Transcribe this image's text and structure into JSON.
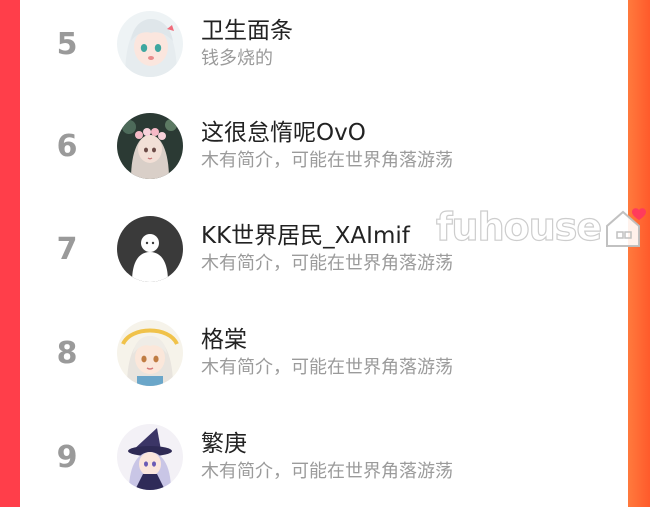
{
  "list": {
    "rows": [
      {
        "rank": "5",
        "name": "卫生面条",
        "desc": "钱多烧的",
        "avatar": "anime-girl-white-hair-avatar"
      },
      {
        "rank": "6",
        "name": "这很怠惰呢OvO",
        "desc": "木有简介，可能在世界角落游荡",
        "avatar": "doll-flower-crown-avatar"
      },
      {
        "rank": "7",
        "name": "KK世界居民_XAImif",
        "desc": "木有简介，可能在世界角落游荡",
        "avatar": "default-user-avatar"
      },
      {
        "rank": "8",
        "name": "格棠",
        "desc": "木有简介，可能在世界角落游荡",
        "avatar": "anime-girl-gold-halo-avatar"
      },
      {
        "rank": "9",
        "name": "繁庚",
        "desc": "木有简介，可能在世界角落游荡",
        "avatar": "anime-witch-hat-avatar"
      }
    ]
  },
  "watermark": {
    "text": "fuhouse",
    "icon": "house-heart-icon",
    "accent": "#ff3b5c"
  },
  "colors": {
    "left_edge": "#ff3e4a",
    "right_edge": "#ff6a30",
    "rank": "#9a9a9a",
    "name": "#222222",
    "desc": "#9b9b9b"
  }
}
